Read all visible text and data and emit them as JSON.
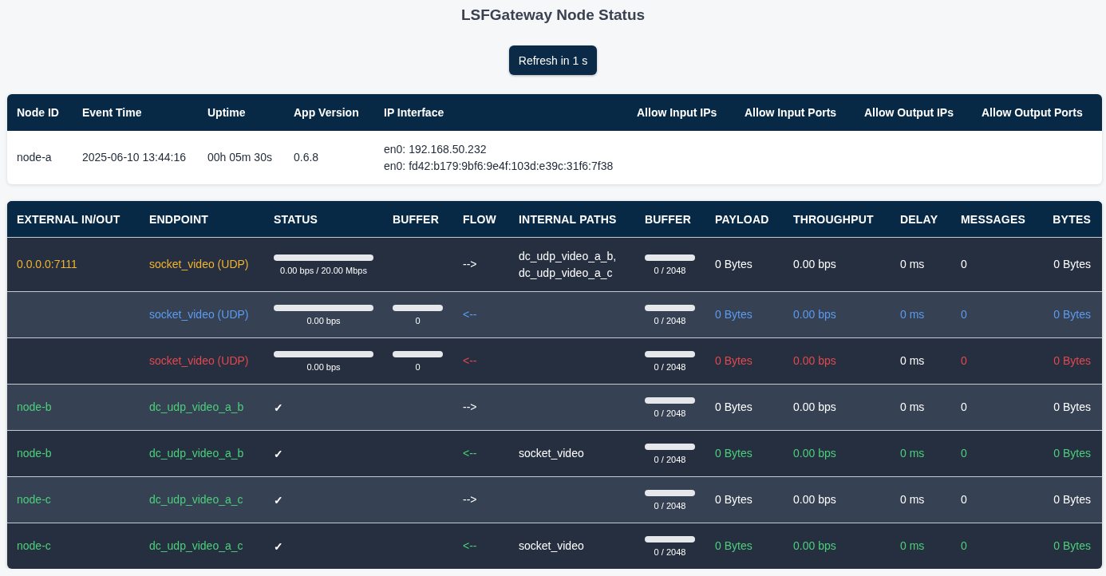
{
  "title": "LSFGateway Node Status",
  "refresh_button": "Refresh in 1 s",
  "node_info": {
    "columns": [
      "Node ID",
      "Event Time",
      "Uptime",
      "App Version",
      "IP Interface",
      "Allow Input IPs",
      "Allow Input Ports",
      "Allow Output IPs",
      "Allow Output Ports"
    ],
    "row": [
      [
        "node-a"
      ],
      [
        "2025-06-10 13:44:16"
      ],
      [
        "00h 05m 30s"
      ],
      [
        "0.6.8"
      ],
      [
        "en0: 192.168.50.232",
        "en0: fd42:b179:9bf6:9e4f:103d:e39c:31f6:7f38"
      ]
    ]
  },
  "endpoints": {
    "columns": [
      "EXTERNAL IN/OUT",
      "ENDPOINT",
      "STATUS",
      "BUFFER",
      "FLOW",
      "INTERNAL PATHS",
      "BUFFER",
      "PAYLOAD",
      "THROUGHPUT",
      "DELAY",
      "MESSAGES",
      "BYTES"
    ],
    "rows": [
      {
        "external": {
          "text": "0.0.0.0:7111",
          "color": "#f2b32e"
        },
        "endpoint": {
          "text": "socket_video (UDP)",
          "color": "#f2b32e"
        },
        "status": {
          "kind": "meter",
          "level": 0,
          "reading": "0.00 bps / 20.00 Mbps"
        },
        "flow": {
          "text": "-->"
        },
        "internal_paths": {
          "text": "dc_udp_video_a_b, dc_udp_video_a_c"
        },
        "buffer_2": {
          "level": 0,
          "reading": "0 / 2048"
        },
        "payload": {
          "text": "0 Bytes"
        },
        "throughput": {
          "text": "0.00 bps"
        },
        "delay": {
          "text": "0 ms"
        },
        "messages": {
          "text": "0"
        },
        "bytes": {
          "text": "0 Bytes"
        }
      },
      {
        "endpoint": {
          "text": "socket_video (UDP)",
          "color": "#5b9cf0"
        },
        "status": {
          "kind": "meter",
          "level": 0,
          "reading": "0.00 bps"
        },
        "buffer": {
          "level": 0,
          "reading": "0"
        },
        "flow": {
          "text": "<--",
          "color": "#5b9cf0"
        },
        "buffer_2": {
          "level": 0,
          "reading": "0 / 2048"
        },
        "payload": {
          "text": "0 Bytes",
          "color": "#5b9cf0"
        },
        "throughput": {
          "text": "0.00 bps",
          "color": "#5b9cf0"
        },
        "delay": {
          "text": "0 ms",
          "color": "#5b9cf0"
        },
        "messages": {
          "text": "0",
          "color": "#5b9cf0"
        },
        "bytes": {
          "text": "0 Bytes",
          "color": "#5b9cf0"
        }
      },
      {
        "endpoint": {
          "text": "socket_video (UDP)",
          "color": "#e5484d"
        },
        "status": {
          "kind": "meter",
          "level": 0,
          "reading": "0.00 bps"
        },
        "buffer": {
          "level": 0,
          "reading": "0"
        },
        "flow": {
          "text": "<--",
          "color": "#e5484d"
        },
        "buffer_2": {
          "level": 0,
          "reading": "0 / 2048"
        },
        "payload": {
          "text": "0 Bytes",
          "color": "#e5484d"
        },
        "throughput": {
          "text": "0.00 bps",
          "color": "#e5484d"
        },
        "delay": {
          "text": "0 ms"
        },
        "messages": {
          "text": "0",
          "color": "#e5484d"
        },
        "bytes": {
          "text": "0 Bytes",
          "color": "#e5484d"
        }
      },
      {
        "external": {
          "text": "node-b",
          "color": "#4ad07a"
        },
        "endpoint": {
          "text": "dc_udp_video_a_b",
          "color": "#4ad07a"
        },
        "status": {
          "kind": "check",
          "text": "✓"
        },
        "flow": {
          "text": "-->"
        },
        "buffer_2": {
          "level": 0,
          "reading": "0 / 2048"
        },
        "payload": {
          "text": "0 Bytes"
        },
        "throughput": {
          "text": "0.00 bps"
        },
        "delay": {
          "text": "0 ms"
        },
        "messages": {
          "text": "0"
        },
        "bytes": {
          "text": "0 Bytes"
        }
      },
      {
        "external": {
          "text": "node-b",
          "color": "#4ad07a"
        },
        "endpoint": {
          "text": "dc_udp_video_a_b",
          "color": "#4ad07a"
        },
        "status": {
          "kind": "check",
          "text": "✓"
        },
        "flow": {
          "text": "<--",
          "color": "#4ad07a"
        },
        "internal_paths": {
          "text": "socket_video"
        },
        "buffer_2": {
          "level": 0,
          "reading": "0 / 2048"
        },
        "payload": {
          "text": "0 Bytes",
          "color": "#4ad07a"
        },
        "throughput": {
          "text": "0.00 bps",
          "color": "#4ad07a"
        },
        "delay": {
          "text": "0 ms",
          "color": "#4ad07a"
        },
        "messages": {
          "text": "0",
          "color": "#4ad07a"
        },
        "bytes": {
          "text": "0 Bytes",
          "color": "#4ad07a"
        }
      },
      {
        "external": {
          "text": "node-c",
          "color": "#4ad07a"
        },
        "endpoint": {
          "text": "dc_udp_video_a_c",
          "color": "#4ad07a"
        },
        "status": {
          "kind": "check",
          "text": "✓"
        },
        "flow": {
          "text": "-->"
        },
        "buffer_2": {
          "level": 0,
          "reading": "0 / 2048"
        },
        "payload": {
          "text": "0 Bytes"
        },
        "throughput": {
          "text": "0.00 bps"
        },
        "delay": {
          "text": "0 ms"
        },
        "messages": {
          "text": "0"
        },
        "bytes": {
          "text": "0 Bytes"
        }
      },
      {
        "external": {
          "text": "node-c",
          "color": "#4ad07a"
        },
        "endpoint": {
          "text": "dc_udp_video_a_c",
          "color": "#4ad07a"
        },
        "status": {
          "kind": "check",
          "text": "✓"
        },
        "flow": {
          "text": "<--",
          "color": "#4ad07a"
        },
        "internal_paths": {
          "text": "socket_video"
        },
        "buffer_2": {
          "level": 0,
          "reading": "0 / 2048"
        },
        "payload": {
          "text": "0 Bytes",
          "color": "#4ad07a"
        },
        "throughput": {
          "text": "0.00 bps",
          "color": "#4ad07a"
        },
        "delay": {
          "text": "0 ms",
          "color": "#4ad07a"
        },
        "messages": {
          "text": "0",
          "color": "#4ad07a"
        },
        "bytes": {
          "text": "0 Bytes",
          "color": "#4ad07a"
        }
      }
    ]
  }
}
